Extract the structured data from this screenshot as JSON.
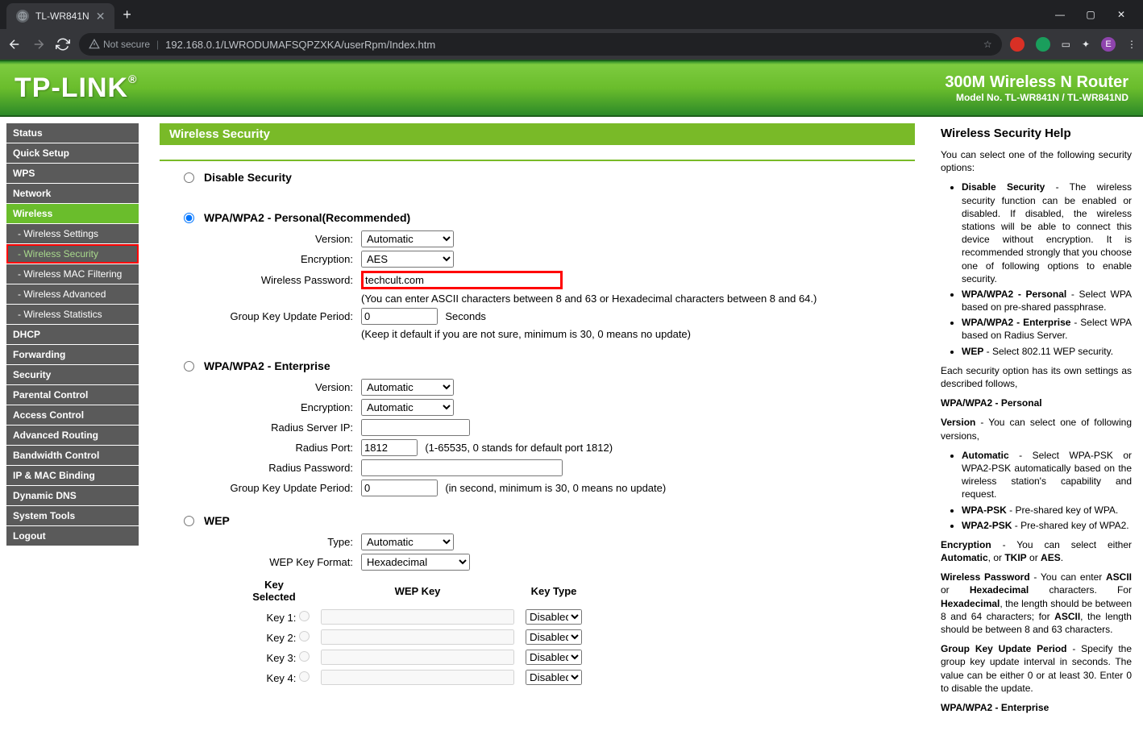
{
  "browser": {
    "tab_title": "TL-WR841N",
    "insecure_label": "Not secure",
    "url": "192.168.0.1/LWRODUMAFSQPZXKA/userRpm/Index.htm"
  },
  "header": {
    "logo": "TP-LINK",
    "title": "300M Wireless N Router",
    "model": "Model No. TL-WR841N / TL-WR841ND"
  },
  "sidebar": {
    "items": [
      {
        "label": "Status"
      },
      {
        "label": "Quick Setup"
      },
      {
        "label": "WPS"
      },
      {
        "label": "Network"
      },
      {
        "label": "Wireless",
        "active": true
      },
      {
        "label": "- Wireless Settings",
        "sub": true
      },
      {
        "label": "- Wireless Security",
        "sub": true,
        "highlighted": true
      },
      {
        "label": "- Wireless MAC Filtering",
        "sub": true
      },
      {
        "label": "- Wireless Advanced",
        "sub": true
      },
      {
        "label": "- Wireless Statistics",
        "sub": true
      },
      {
        "label": "DHCP"
      },
      {
        "label": "Forwarding"
      },
      {
        "label": "Security"
      },
      {
        "label": "Parental Control"
      },
      {
        "label": "Access Control"
      },
      {
        "label": "Advanced Routing"
      },
      {
        "label": "Bandwidth Control"
      },
      {
        "label": "IP & MAC Binding"
      },
      {
        "label": "Dynamic DNS"
      },
      {
        "label": "System Tools"
      },
      {
        "label": "Logout"
      }
    ]
  },
  "page": {
    "title": "Wireless Security",
    "disable_label": "Disable Security",
    "wpa_personal": {
      "title": "WPA/WPA2 - Personal(Recommended)",
      "version_label": "Version:",
      "version_value": "Automatic",
      "encryption_label": "Encryption:",
      "encryption_value": "AES",
      "password_label": "Wireless Password:",
      "password_value": "techcult.com",
      "password_hint": "(You can enter ASCII characters between 8 and 63 or Hexadecimal characters between 8 and 64.)",
      "gkup_label": "Group Key Update Period:",
      "gkup_value": "0",
      "gkup_unit": "Seconds",
      "gkup_hint": "(Keep it default if you are not sure, minimum is 30, 0 means no update)"
    },
    "wpa_enterprise": {
      "title": "WPA/WPA2 - Enterprise",
      "version_label": "Version:",
      "version_value": "Automatic",
      "encryption_label": "Encryption:",
      "encryption_value": "Automatic",
      "radius_ip_label": "Radius Server IP:",
      "radius_ip_value": "",
      "radius_port_label": "Radius Port:",
      "radius_port_value": "1812",
      "radius_port_hint": "(1-65535, 0 stands for default port 1812)",
      "radius_pw_label": "Radius Password:",
      "radius_pw_value": "",
      "gkup_label": "Group Key Update Period:",
      "gkup_value": "0",
      "gkup_hint": "(in second, minimum is 30, 0 means no update)"
    },
    "wep": {
      "title": "WEP",
      "type_label": "Type:",
      "type_value": "Automatic",
      "format_label": "WEP Key Format:",
      "format_value": "Hexadecimal",
      "col_selected": "Key Selected",
      "col_key": "WEP Key",
      "col_type": "Key Type",
      "keys": [
        {
          "label": "Key 1:",
          "type": "Disabled"
        },
        {
          "label": "Key 2:",
          "type": "Disabled"
        },
        {
          "label": "Key 3:",
          "type": "Disabled"
        },
        {
          "label": "Key 4:",
          "type": "Disabled"
        }
      ]
    }
  },
  "help": {
    "title": "Wireless Security Help",
    "intro": "You can select one of the following security options:",
    "opts": [
      {
        "b": "Disable Security",
        "t": " - The wireless security function can be enabled or disabled. If disabled, the wireless stations will be able to connect this device without encryption. It is recommended strongly that you choose one of following options to enable security."
      },
      {
        "b": "WPA/WPA2 - Personal",
        "t": " - Select WPA based on pre-shared passphrase."
      },
      {
        "b": "WPA/WPA2 - Enterprise",
        "t": " - Select WPA based on Radius Server."
      },
      {
        "b": "WEP",
        "t": " - Select 802.11 WEP security."
      }
    ],
    "each": "Each security option has its own settings as described follows,",
    "s1": "WPA/WPA2 - Personal",
    "version_p": " - You can select one of following versions,",
    "version_b": "Version",
    "ver_opts": [
      {
        "b": "Automatic",
        "t": " - Select WPA-PSK or WPA2-PSK automatically based on the wireless station's capability and request."
      },
      {
        "b": "WPA-PSK",
        "t": " - Pre-shared key of WPA."
      },
      {
        "b": "WPA2-PSK",
        "t": " - Pre-shared key of WPA2."
      }
    ],
    "enc_b": "Encryption",
    "enc_p": " - You can select either Automatic, or TKIP or AES.",
    "pw_b": "Wireless Password",
    "pw_p": " - You can enter ASCII or Hexadecimal characters. For Hexadecimal, the length should be between 8 and 64 characters; for ASCII, the length should be between 8 and 63 characters.",
    "gk_b": "Group Key Update Period",
    "gk_p": " - Specify the group key update interval in seconds. The value can be either 0 or at least 30. Enter 0 to disable the update.",
    "s2": "WPA/WPA2 - Enterprise"
  }
}
